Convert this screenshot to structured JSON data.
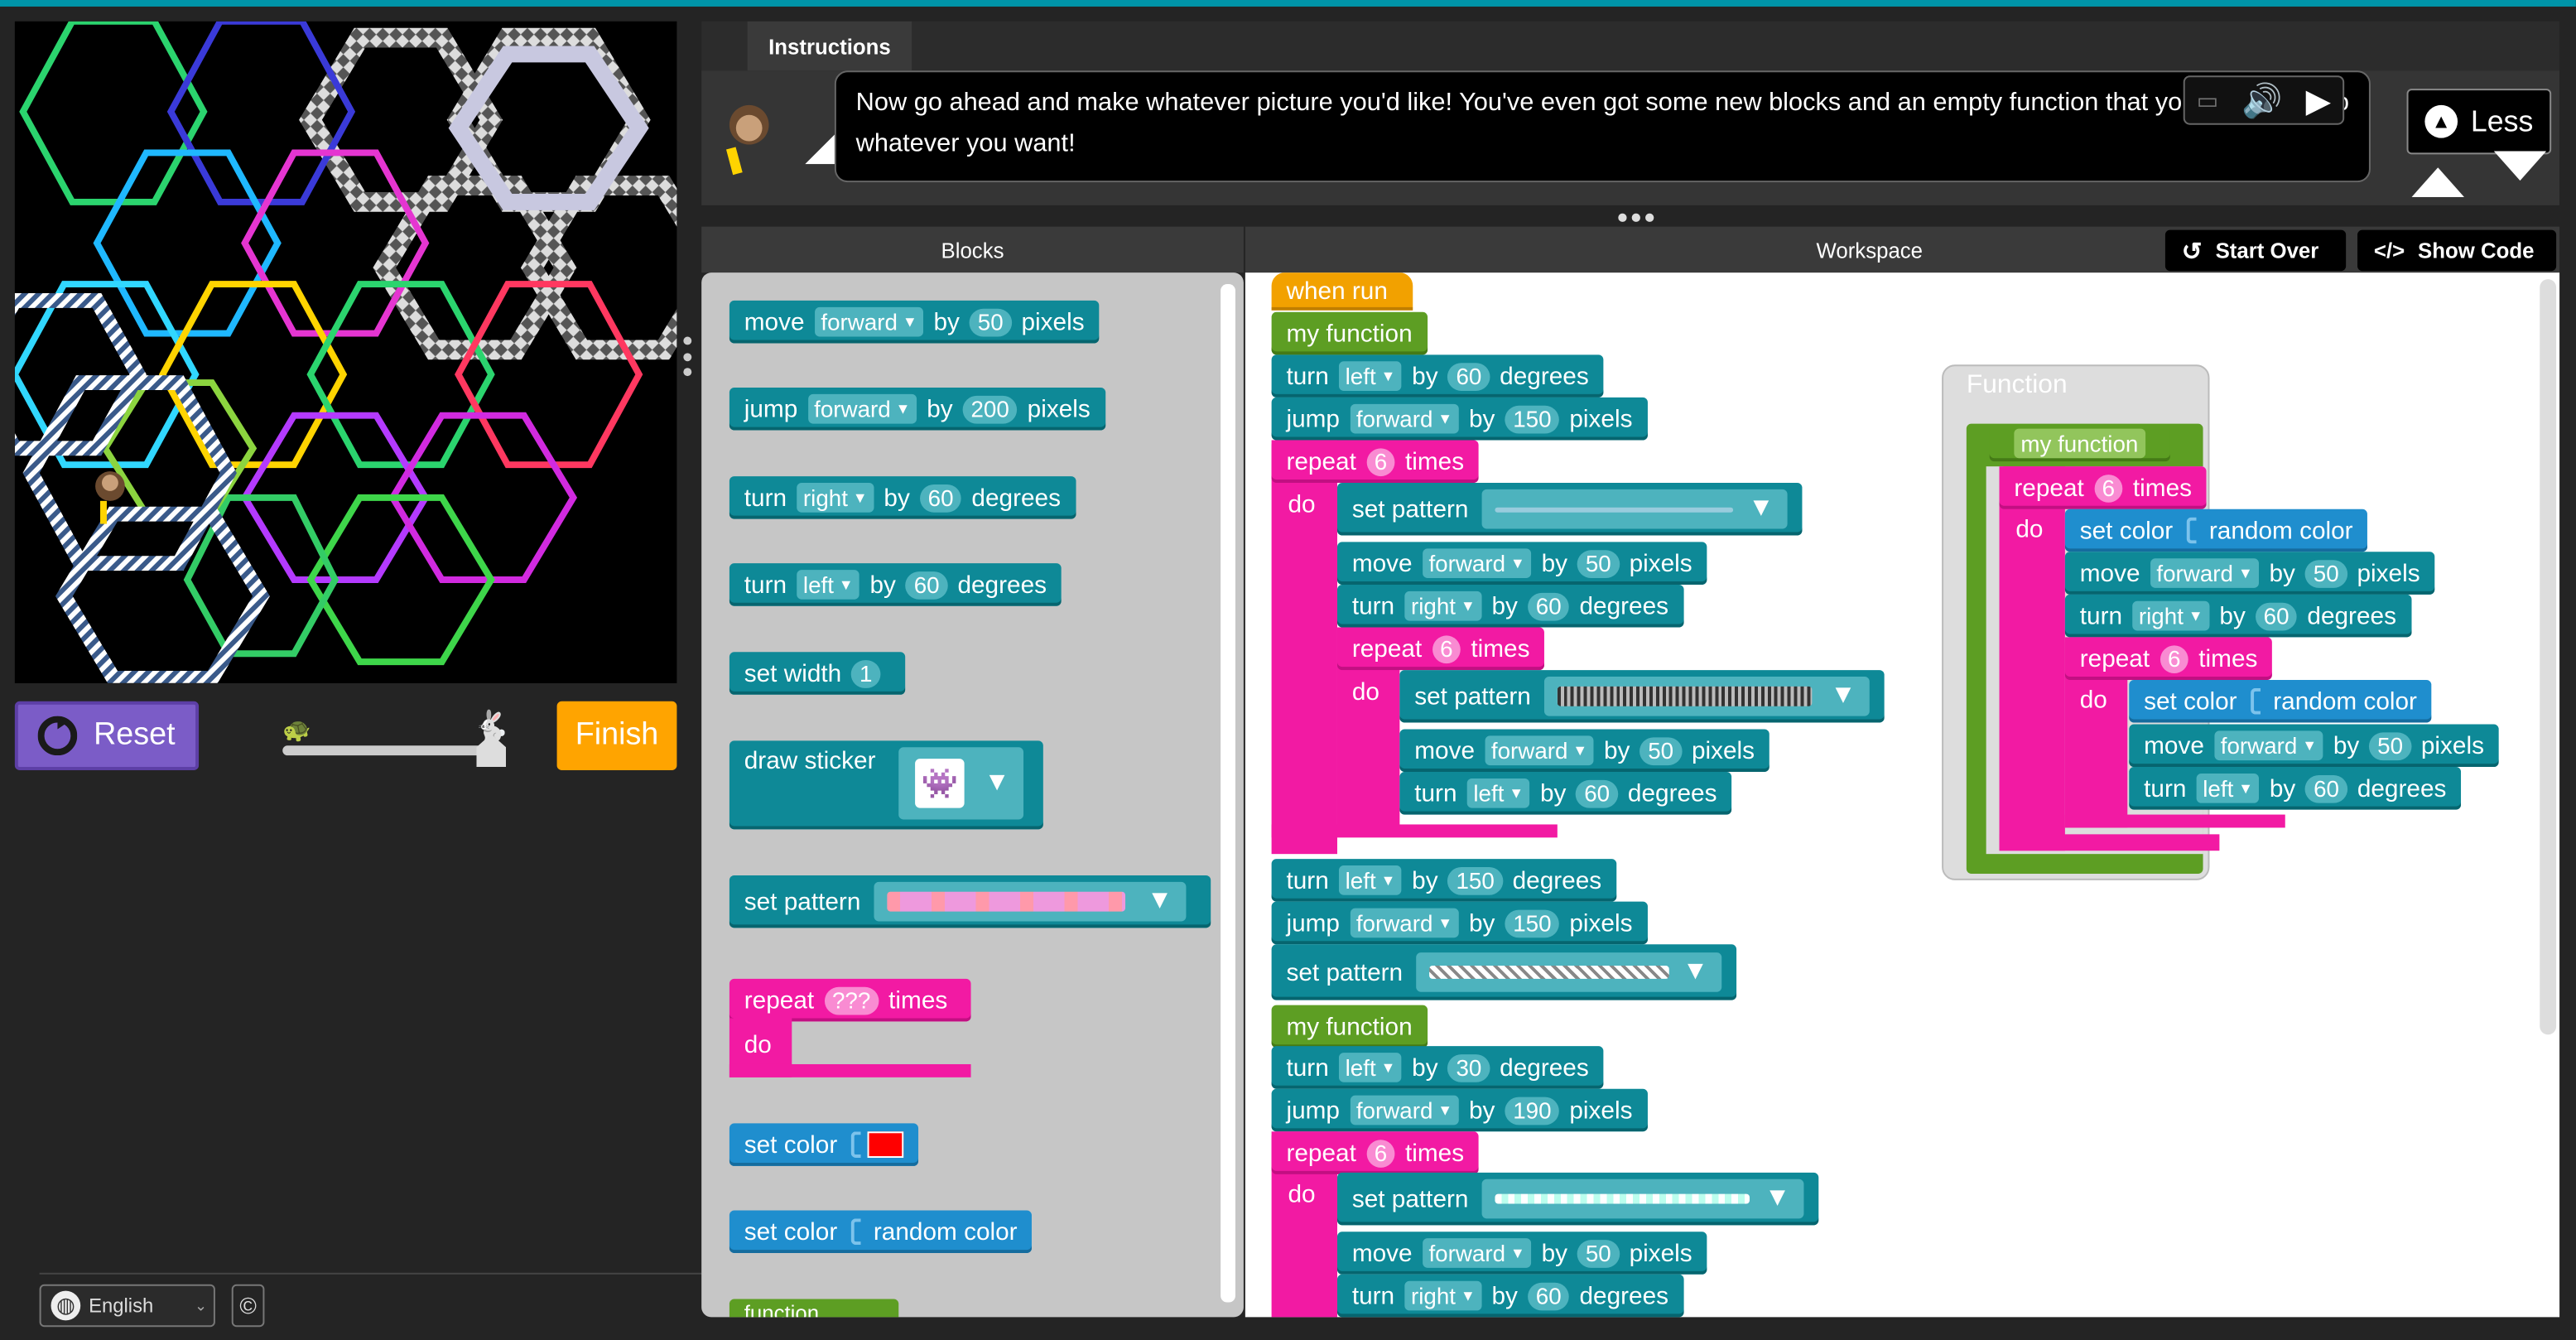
{
  "left": {
    "reset": "Reset",
    "finish": "Finish",
    "language": "English",
    "copyright": "©",
    "speed_slow_icon": "turtle-icon",
    "speed_fast_icon": "rabbit-icon"
  },
  "instructions": {
    "tab": "Instructions",
    "text": "Now go ahead and make whatever picture you'd like! You've even got some new blocks and an empty function that you can make do whatever you want!",
    "less": "Less"
  },
  "headers": {
    "blocks": "Blocks",
    "workspace": "Workspace",
    "start_over": "Start Over",
    "show_code": "Show Code"
  },
  "words": {
    "move": "move",
    "jump": "jump",
    "turn": "turn",
    "by": "by",
    "pixels": "pixels",
    "degrees": "degrees",
    "forward": "forward",
    "left": "left",
    "right": "right",
    "repeat": "repeat",
    "times": "times",
    "do": "do",
    "set_pattern": "set pattern",
    "set_color": "set color",
    "random_color": "random color",
    "set_width": "set width",
    "draw_sticker": "draw sticker",
    "when_run": "when run",
    "my_function": "my function",
    "function": "Function",
    "function_partial": "function"
  },
  "flyout": {
    "move_px": "50",
    "jump_px": "200",
    "turn_right_deg": "60",
    "turn_left_deg": "60",
    "width": "1",
    "repeat_count": "???"
  },
  "workspace": {
    "t1": "60",
    "j1": "150",
    "r1": "6",
    "m1": "50",
    "t2": "60",
    "r2": "6",
    "m2": "50",
    "t3": "60",
    "t4": "150",
    "j2": "150",
    "t5": "30",
    "j3": "190",
    "r3": "6",
    "m3": "50",
    "t6": "60"
  },
  "function_def": {
    "r": "6",
    "m1": "50",
    "t1": "60",
    "r2": "6",
    "m2": "50",
    "t2": "60"
  },
  "colors": {
    "teal": "#0e8997",
    "pink": "#f21aa3",
    "green": "#5d9e23",
    "orange": "#f2a100",
    "blue": "#1f8ece",
    "reset": "#7b5cc7",
    "finish": "#ffa400"
  }
}
